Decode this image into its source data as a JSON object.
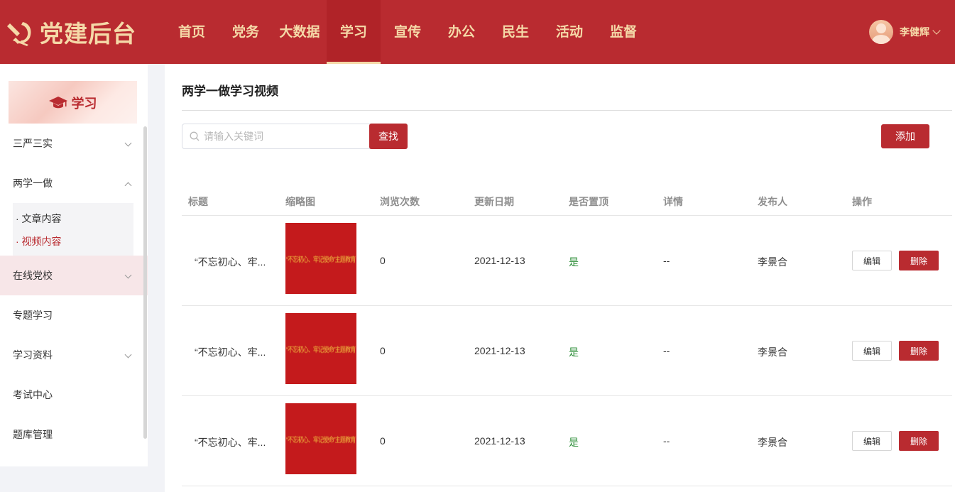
{
  "header": {
    "app_title": "党建后台",
    "nav": [
      "首页",
      "党务",
      "大数据",
      "学习",
      "宣传",
      "办公",
      "民生",
      "活动",
      "监督"
    ],
    "active_nav": "学习",
    "user_name": "李健辉"
  },
  "sidebar": {
    "banner_label": "学习",
    "items": [
      {
        "label": "三严三实"
      },
      {
        "label": "两学一做"
      },
      {
        "label": "在线党校"
      },
      {
        "label": "专题学习"
      },
      {
        "label": "学习资料"
      },
      {
        "label": "考试中心"
      },
      {
        "label": "题库管理"
      }
    ],
    "sub_items": [
      {
        "label": "· 文章内容"
      },
      {
        "label": "· 视频内容"
      }
    ]
  },
  "main": {
    "title": "两学一做学习视频",
    "search": {
      "placeholder": "请输入关键词",
      "value": ""
    },
    "search_button": "查找",
    "add_button": "添加",
    "columns": [
      "标题",
      "缩略图",
      "浏览次数",
      "更新日期",
      "是否置顶",
      "详情",
      "发布人",
      "操作"
    ],
    "rows": [
      {
        "title": "“不忘初心、牢...",
        "thumb_text": "“不忘初心、牢记使命”主题教育",
        "views": "0",
        "date": "2021-12-13",
        "pinned": "是",
        "detail": "--",
        "publisher": "李景合"
      },
      {
        "title": "“不忘初心、牢...",
        "thumb_text": "“不忘初心、牢记使命”主题教育",
        "views": "0",
        "date": "2021-12-13",
        "pinned": "是",
        "detail": "--",
        "publisher": "李景合"
      },
      {
        "title": "“不忘初心、牢...",
        "thumb_text": "“不忘初心、牢记使命”主题教育",
        "views": "0",
        "date": "2021-12-13",
        "pinned": "是",
        "detail": "--",
        "publisher": "李景合"
      }
    ],
    "edit_label": "编辑",
    "delete_label": "删除"
  },
  "colors": {
    "brand_red": "#b92b30",
    "header_gold": "#f5d9a8",
    "pinned_green": "#2f8f3a"
  }
}
